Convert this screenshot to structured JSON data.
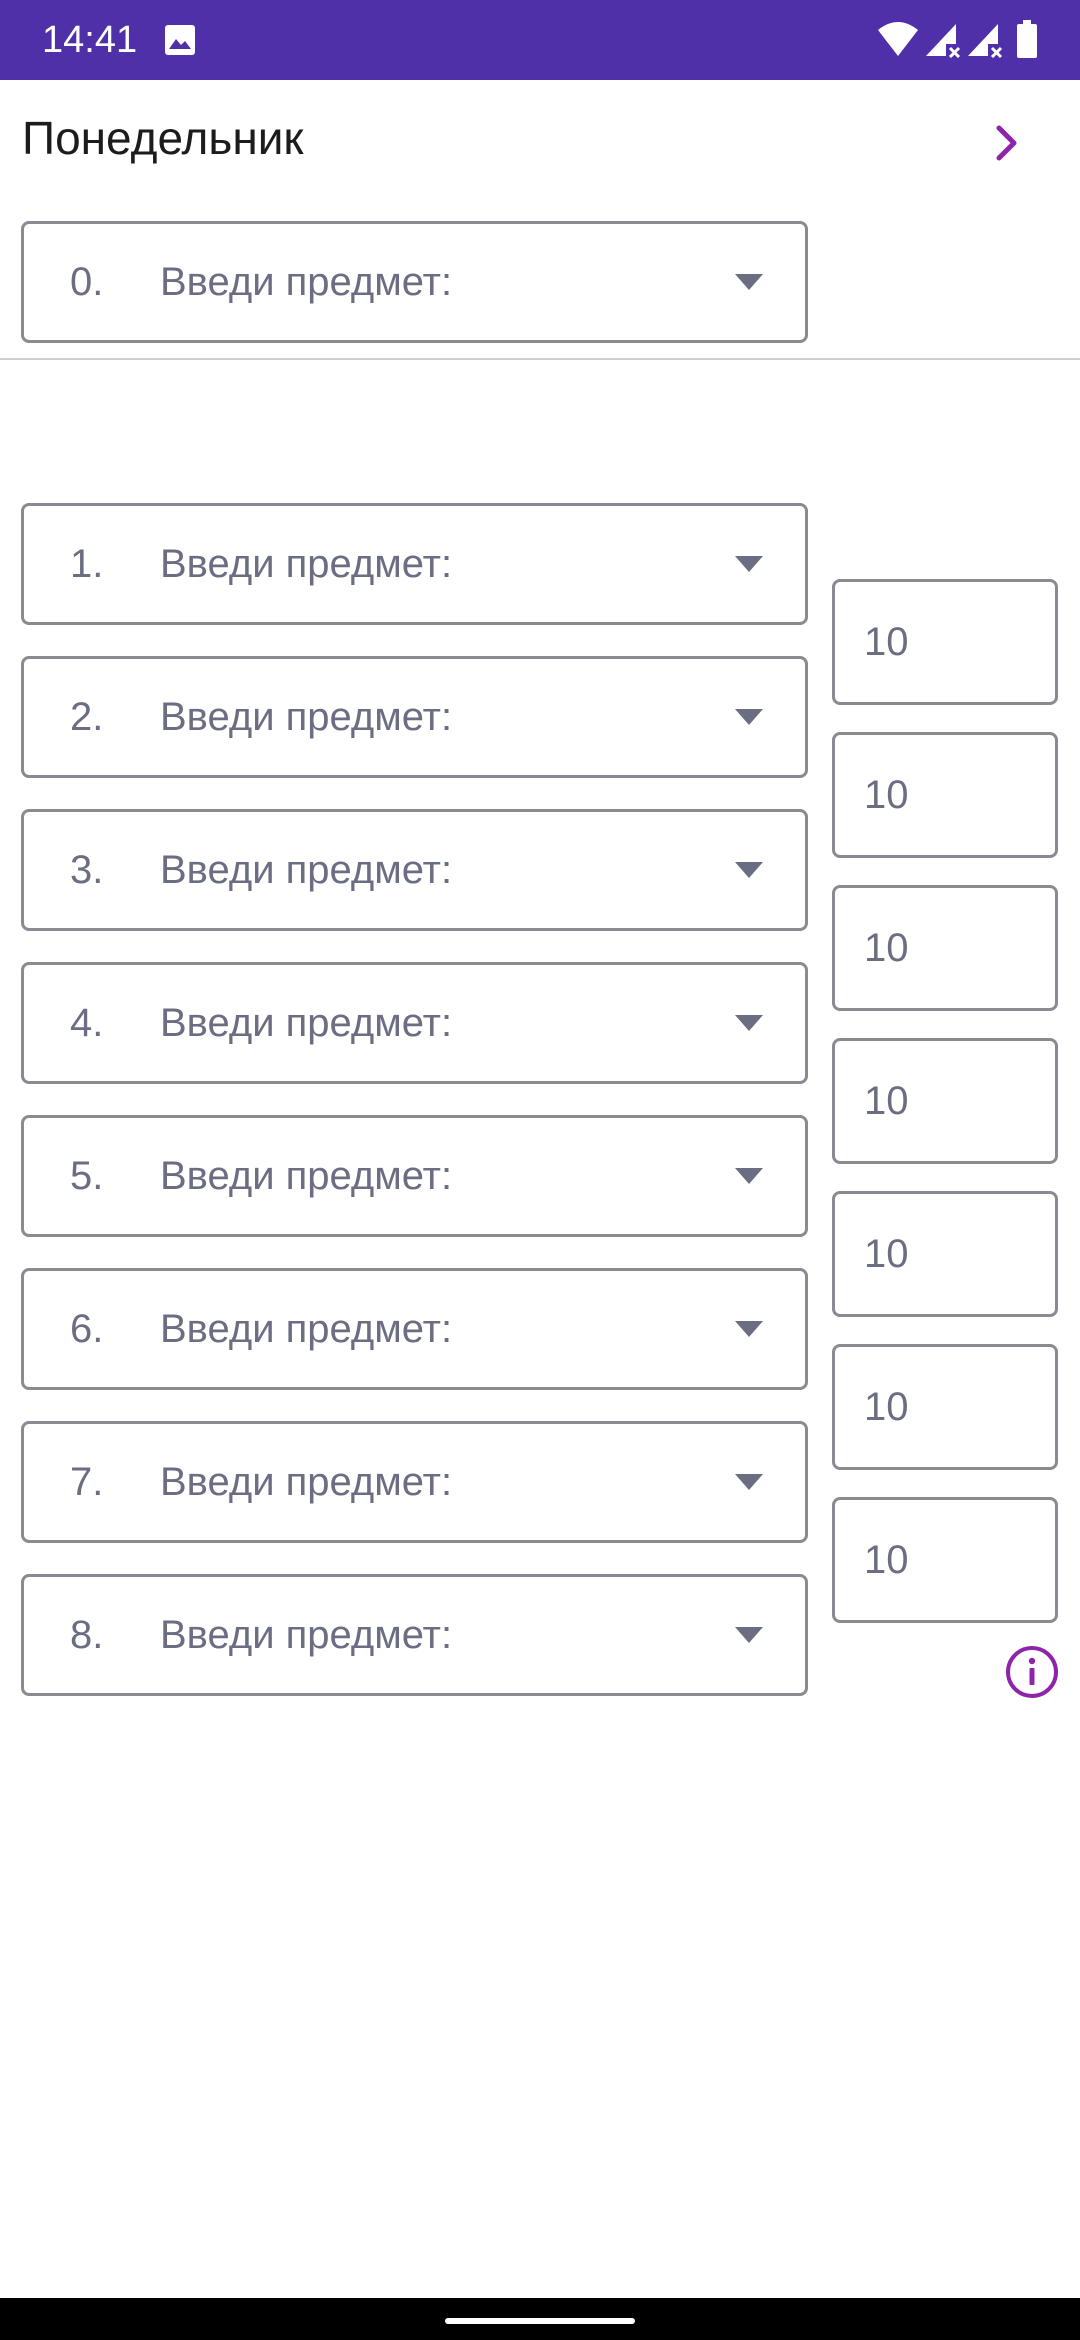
{
  "status_bar": {
    "time": "14:41",
    "background_color": "#5030a8",
    "icons": [
      "image-notification-icon",
      "wifi-icon",
      "signal-no-service-icon",
      "signal-no-service-icon",
      "battery-icon"
    ]
  },
  "header": {
    "day_title": "Понедельник",
    "next_icon": "chevron-right-icon",
    "accent_color": "#8e24aa"
  },
  "subjects": [
    {
      "number": "0.",
      "placeholder": "Введи предмет:"
    },
    {
      "number": "1.",
      "placeholder": "Введи предмет:"
    },
    {
      "number": "2.",
      "placeholder": "Введи предмет:"
    },
    {
      "number": "3.",
      "placeholder": "Введи предмет:"
    },
    {
      "number": "4.",
      "placeholder": "Введи предмет:"
    },
    {
      "number": "5.",
      "placeholder": "Введи предмет:"
    },
    {
      "number": "6.",
      "placeholder": "Введи предмет:"
    },
    {
      "number": "7.",
      "placeholder": "Введи предмет:"
    },
    {
      "number": "8.",
      "placeholder": "Введи предмет:"
    }
  ],
  "grades": [
    "10",
    "10",
    "10",
    "10",
    "10",
    "10",
    "10"
  ],
  "info_icon": "info-circle-icon",
  "colors": {
    "field_border": "#8a8a92",
    "field_text": "#6b6e83",
    "title_text": "#1c1c1c"
  }
}
